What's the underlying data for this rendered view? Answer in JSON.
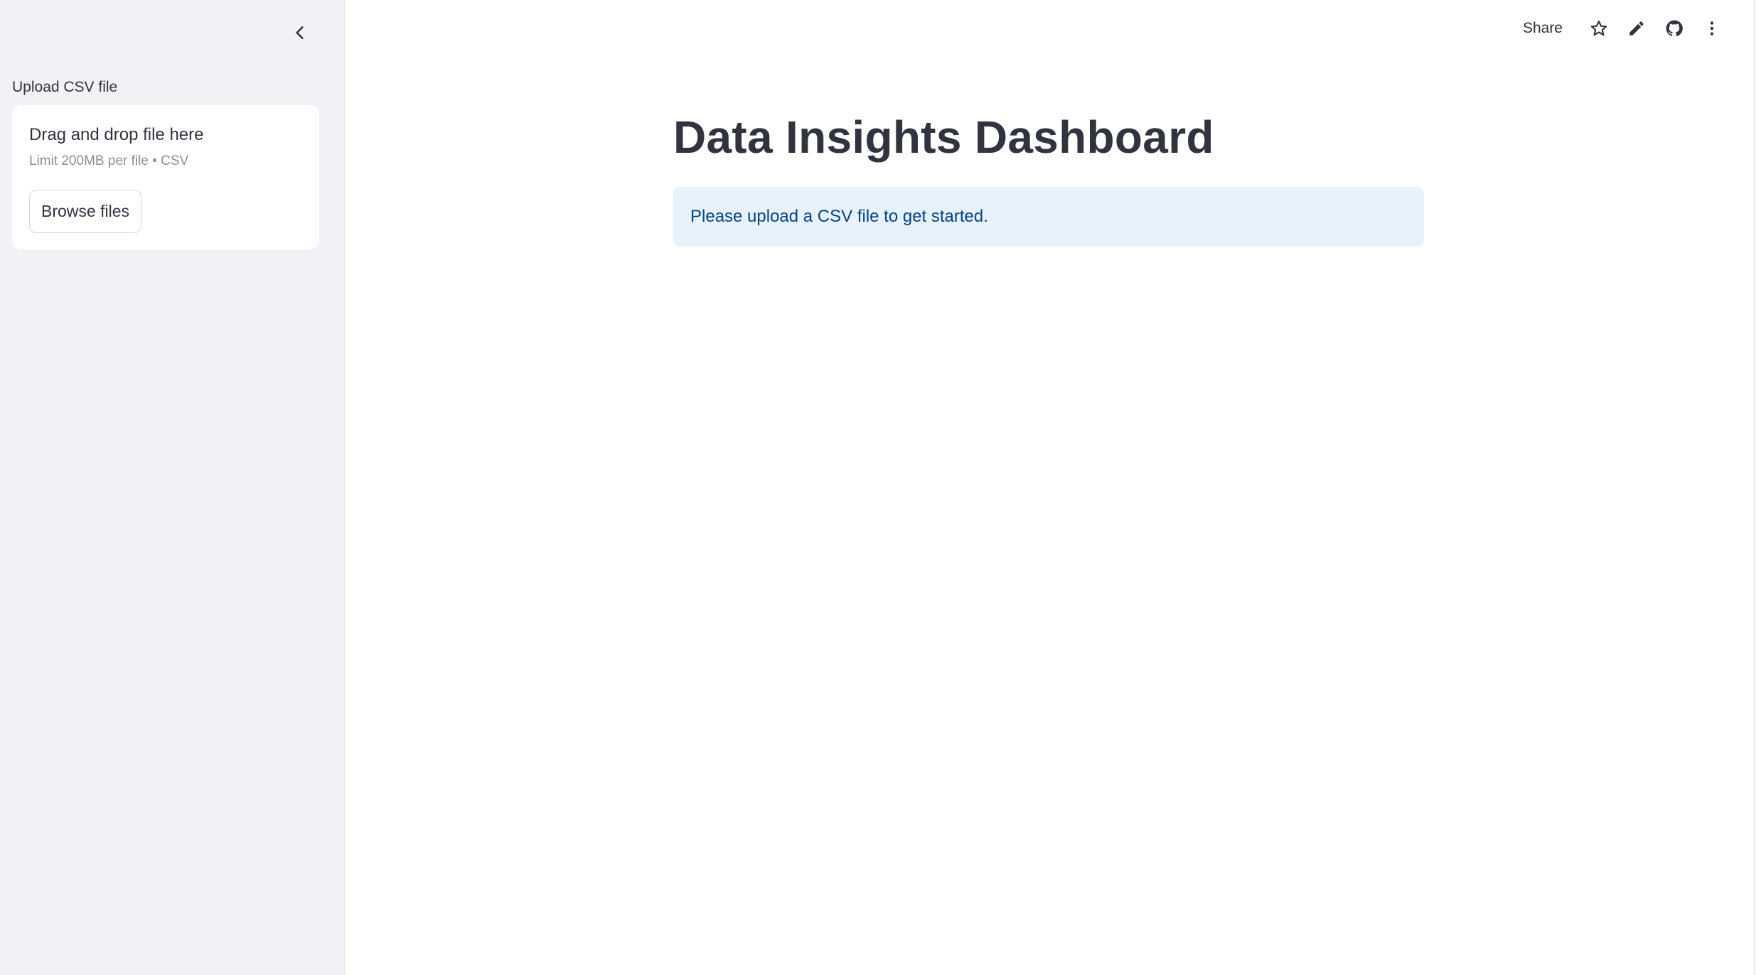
{
  "sidebar": {
    "upload_label": "Upload CSV file",
    "dropzone": {
      "title": "Drag and drop file here",
      "subtitle": "Limit 200MB per file • CSV",
      "browse_label": "Browse files"
    }
  },
  "toolbar": {
    "share_label": "Share",
    "icons": [
      "star-icon",
      "pencil-icon",
      "github-icon",
      "more-vertical-icon"
    ]
  },
  "main": {
    "title": "Data Insights Dashboard",
    "info_message": "Please upload a CSV file to get started."
  },
  "colors": {
    "sidebar_bg": "#f0f2f6",
    "info_bg": "#e8f2fc",
    "info_text": "#004280",
    "text": "#31333f"
  }
}
